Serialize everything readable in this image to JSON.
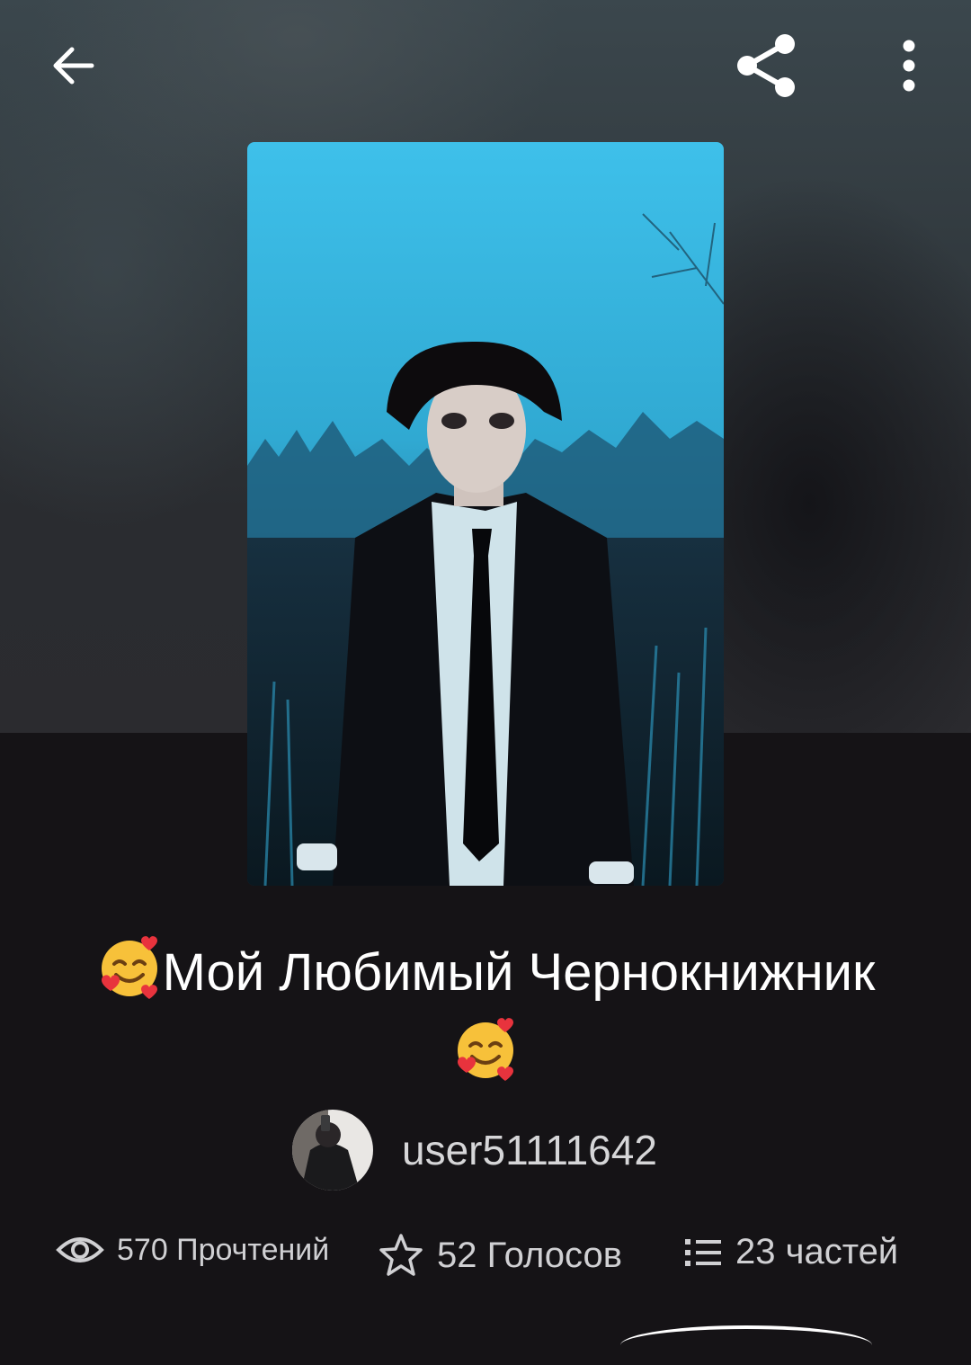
{
  "story": {
    "title": "Мой Любимый Чернокнижник",
    "author": "user51111642"
  },
  "stats": {
    "reads": "570 Прочтений",
    "votes": "52 Голосов",
    "parts": "23 частей"
  },
  "icons": {
    "back": "arrow-left-icon",
    "share": "share-icon",
    "more": "more-vertical-icon",
    "reads": "eye-icon",
    "votes": "star-icon",
    "parts": "list-icon"
  },
  "colors": {
    "background": "#151316",
    "hero_background": "#2f3539",
    "cover_sky": "#2fb7e3",
    "text_primary": "#ffffff",
    "text_secondary": "#d0d0d3"
  }
}
